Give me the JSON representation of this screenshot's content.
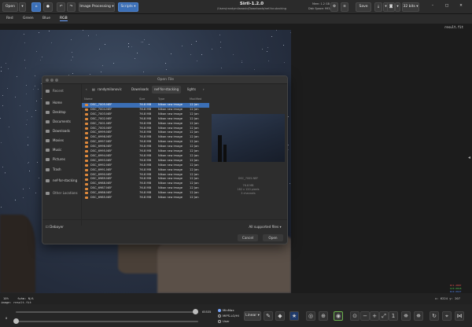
{
  "header": {
    "open_label": "Open",
    "image_processing_label": "Image Processing",
    "scripts_label": "Scripts",
    "title": "Siril-1.2.0",
    "path": "/Users/randymilanovic/Downloads/nef-for-stacking",
    "mem_label": "Mem: 1.2 GB",
    "disk_label": "Disk Space: 993.9 GB",
    "save_label": "Save",
    "bits_label": "32 bits"
  },
  "channel_tabs": [
    "Red",
    "Green",
    "Blue",
    "RGB"
  ],
  "right_panel": {
    "filename": "result.fit",
    "r_value": "R=1.2807",
    "g_value": "G=0.0018",
    "b_value": "B=0.0027"
  },
  "status": {
    "zoom": "10%",
    "fwhm": "fwhm: N/A",
    "image": "image: result.fit",
    "coords": "x: 6224 y: 207",
    "min_label": "0",
    "max_label": "65535"
  },
  "bottom_bar": {
    "minmax_label": "MinMax",
    "mips_label": "MIPS-LO/HI",
    "user_label": "User",
    "stretch_label": "Linear"
  },
  "dialog": {
    "title": "Open File",
    "breadcrumbs": [
      "randymilanovic",
      "Downloads",
      "nef-for-stacking",
      "lights"
    ],
    "sidebar": [
      "Recent",
      "Home",
      "Desktop",
      "Documents",
      "Downloads",
      "Movies",
      "Music",
      "Pictures",
      "Trash",
      "nef-for-stacking",
      "Other Locations"
    ],
    "columns": [
      "Name",
      "Size",
      "Type",
      "Modified"
    ],
    "files": [
      {
        "name": "DSC_7005.NEF",
        "size": "76.8 MB",
        "type": "Nikon raw image",
        "modified": "12 Jan"
      },
      {
        "name": "DSC_7004.NEF",
        "size": "76.8 MB",
        "type": "Nikon raw image",
        "modified": "12 Jan"
      },
      {
        "name": "DSC_7003.NEF",
        "size": "76.8 MB",
        "type": "Nikon raw image",
        "modified": "12 Jan"
      },
      {
        "name": "DSC_7002.NEF",
        "size": "76.8 MB",
        "type": "Nikon raw image",
        "modified": "12 Jan"
      },
      {
        "name": "DSC_7001.NEF",
        "size": "76.8 MB",
        "type": "Nikon raw image",
        "modified": "12 Jan"
      },
      {
        "name": "DSC_7000.NEF",
        "size": "76.8 MB",
        "type": "Nikon raw image",
        "modified": "12 Jan"
      },
      {
        "name": "DSC_6999.NEF",
        "size": "76.8 MB",
        "type": "Nikon raw image",
        "modified": "12 Jan"
      },
      {
        "name": "DSC_6998.NEF",
        "size": "76.8 MB",
        "type": "Nikon raw image",
        "modified": "12 Jan"
      },
      {
        "name": "DSC_6997.NEF",
        "size": "76.8 MB",
        "type": "Nikon raw image",
        "modified": "12 Jan"
      },
      {
        "name": "DSC_6996.NEF",
        "size": "76.8 MB",
        "type": "Nikon raw image",
        "modified": "12 Jan"
      },
      {
        "name": "DSC_6995.NEF",
        "size": "76.8 MB",
        "type": "Nikon raw image",
        "modified": "12 Jan"
      },
      {
        "name": "DSC_6994.NEF",
        "size": "76.8 MB",
        "type": "Nikon raw image",
        "modified": "12 Jan"
      },
      {
        "name": "DSC_6993.NEF",
        "size": "76.8 MB",
        "type": "Nikon raw image",
        "modified": "12 Jan"
      },
      {
        "name": "DSC_6992.NEF",
        "size": "76.8 MB",
        "type": "Nikon raw image",
        "modified": "12 Jan"
      },
      {
        "name": "DSC_6991.NEF",
        "size": "76.8 MB",
        "type": "Nikon raw image",
        "modified": "12 Jan"
      },
      {
        "name": "DSC_6990.NEF",
        "size": "76.8 MB",
        "type": "Nikon raw image",
        "modified": "12 Jan"
      },
      {
        "name": "DSC_6989.NEF",
        "size": "76.8 MB",
        "type": "Nikon raw image",
        "modified": "12 Jan"
      },
      {
        "name": "DSC_6988.NEF",
        "size": "76.8 MB",
        "type": "Nikon raw image",
        "modified": "12 Jan"
      },
      {
        "name": "DSC_6987.NEF",
        "size": "76.8 MB",
        "type": "Nikon raw image",
        "modified": "12 Jan"
      },
      {
        "name": "DSC_6986.NEF",
        "size": "76.8 MB",
        "type": "Nikon raw image",
        "modified": "12 Jan"
      },
      {
        "name": "DSC_6985.NEF",
        "size": "76.8 MB",
        "type": "Nikon raw image",
        "modified": "12 Jan"
      }
    ],
    "preview": {
      "filename": "DSC_7005.NEF",
      "size": "76.8 MB",
      "dims": "182 x 120 pixels",
      "channels": "3 channels"
    },
    "debayer_label": "Debayer",
    "filter_label": "All supported files",
    "cancel_label": "Cancel",
    "open_label": "Open"
  },
  "colors": {
    "accent": "#3b6fb6",
    "selection": "#3b6fb6",
    "file_icon": "#e08a3c",
    "r_text": "#e05050",
    "g_text": "#50c050",
    "b_text": "#5080e0"
  }
}
